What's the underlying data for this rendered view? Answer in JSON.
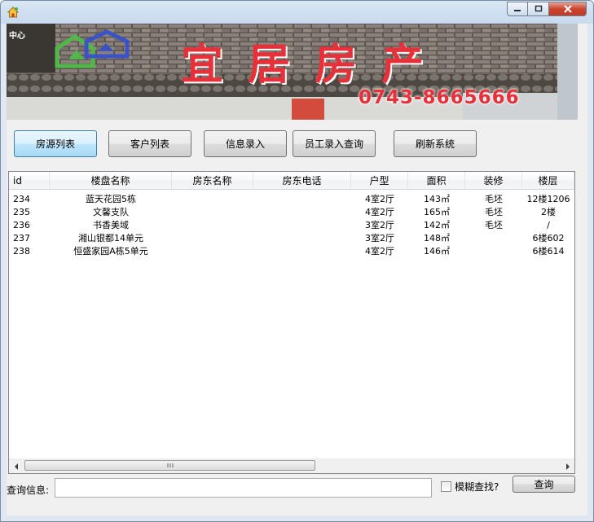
{
  "window": {
    "title": ""
  },
  "banner": {
    "corner_text": "中心",
    "corner_sub": "",
    "sign_text": "宜居房产",
    "phone": "0743-8665666"
  },
  "toolbar": [
    {
      "name": "house-list-button",
      "label": "房源列表",
      "active": true
    },
    {
      "name": "client-list-button",
      "label": "客户列表",
      "active": false
    },
    {
      "name": "info-entry-button",
      "label": "信息录入",
      "active": false
    },
    {
      "name": "staff-entry-query-button",
      "label": "员工录入查询",
      "active": false
    },
    {
      "name": "refresh-system-button",
      "label": "刷新系统",
      "active": false
    }
  ],
  "grid": {
    "columns": [
      "id",
      "楼盘名称",
      "房东名称",
      "房东电话",
      "户型",
      "面积",
      "装修",
      "楼层"
    ],
    "rows": [
      [
        "234",
        "蓝天花园5栋",
        "",
        "",
        "4室2厅",
        "143㎡",
        "毛坯",
        "12楼1206"
      ],
      [
        "235",
        "文馨支队",
        "",
        "",
        "4室2厅",
        "165㎡",
        "毛坯",
        "2楼"
      ],
      [
        "236",
        "书香美域",
        "",
        "",
        "3室2厅",
        "142㎡",
        "毛坯",
        "/"
      ],
      [
        "237",
        "湘山银都14单元",
        "",
        "",
        "3室2厅",
        "148㎡",
        "",
        "6楼602"
      ],
      [
        "238",
        "恒盛家园A栋5单元",
        "",
        "",
        "4室2厅",
        "146㎡",
        "",
        "6楼614"
      ]
    ]
  },
  "search": {
    "label": "查询信息:",
    "value": "",
    "fuzzy_label": "模糊查找?",
    "fuzzy_checked": false,
    "button_label": "查询"
  }
}
